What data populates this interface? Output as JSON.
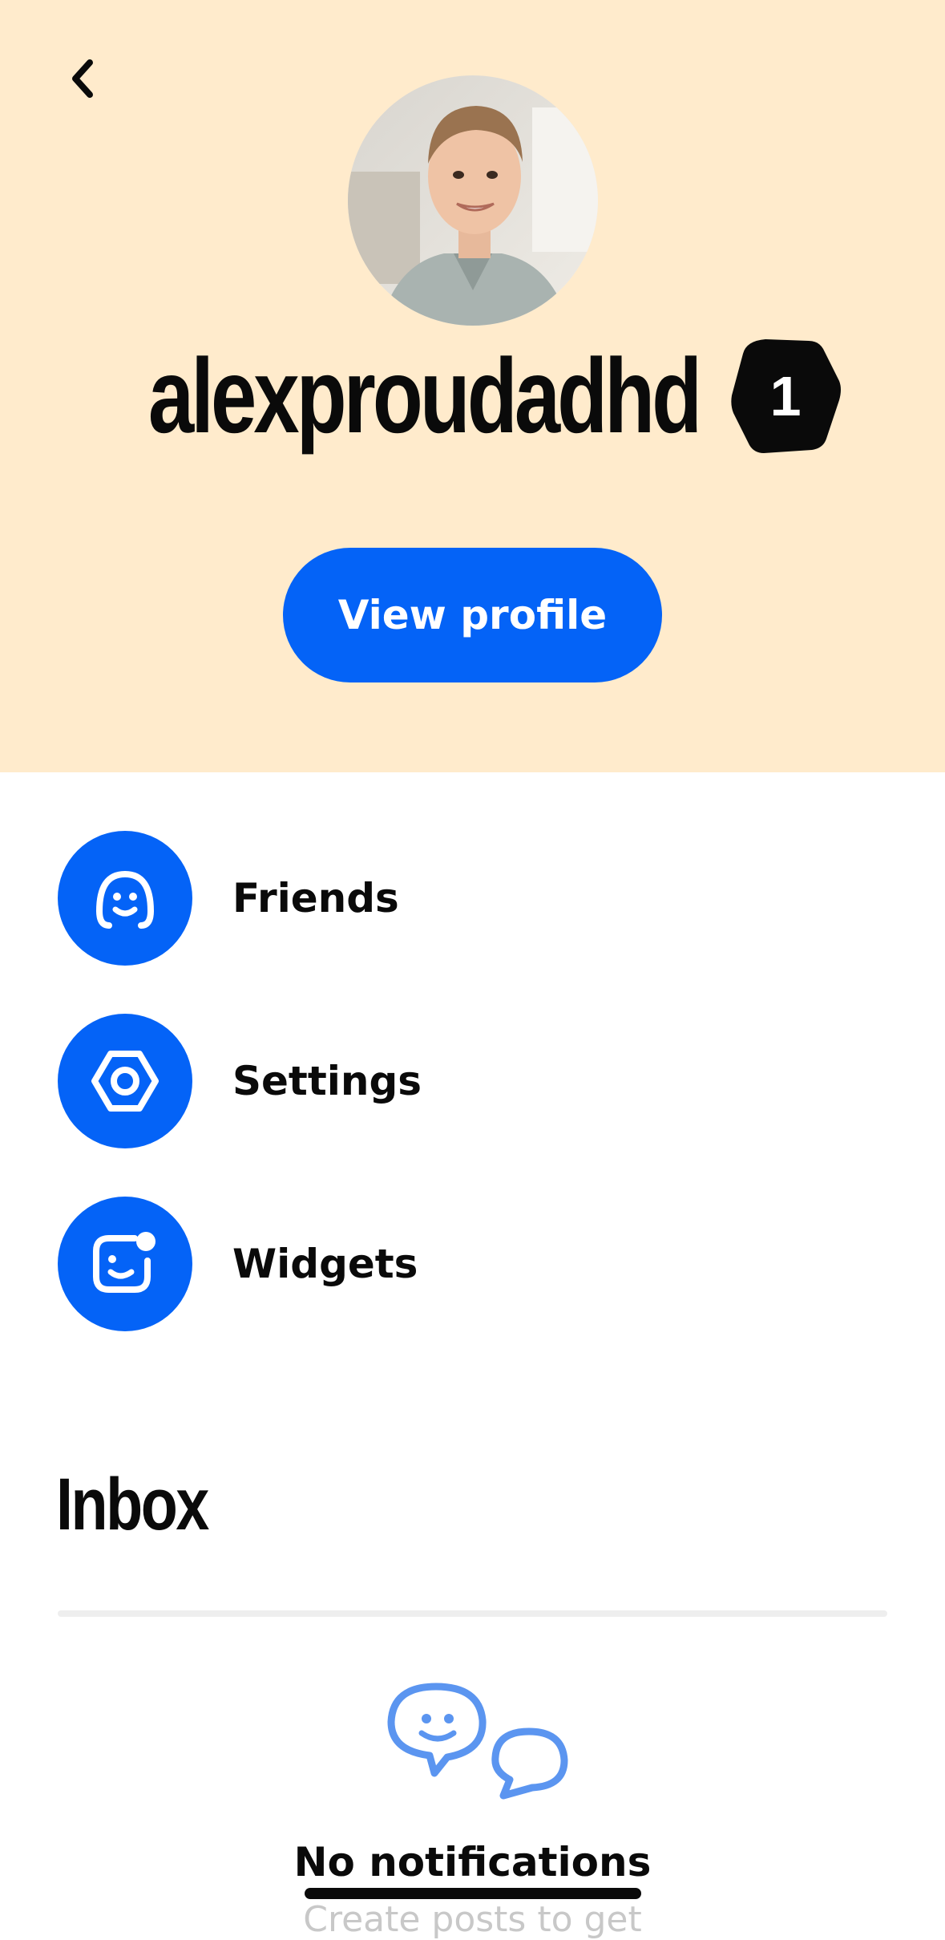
{
  "profile": {
    "username": "alexproudadhd",
    "badge_number": "1",
    "view_profile_label": "View profile"
  },
  "menu": {
    "items": [
      {
        "id": "friends",
        "label": "Friends",
        "icon": "smile-headphones-icon"
      },
      {
        "id": "settings",
        "label": "Settings",
        "icon": "hex-settings-icon"
      },
      {
        "id": "widgets",
        "label": "Widgets",
        "icon": "widget-face-icon"
      }
    ]
  },
  "inbox": {
    "title": "Inbox",
    "empty_title": "No notifications",
    "empty_subtitle": "Create posts to get"
  },
  "colors": {
    "header_bg": "#FFEBCC",
    "accent": "#0463F7",
    "accent_light": "#5B95F0",
    "text": "#0A0A0A"
  }
}
